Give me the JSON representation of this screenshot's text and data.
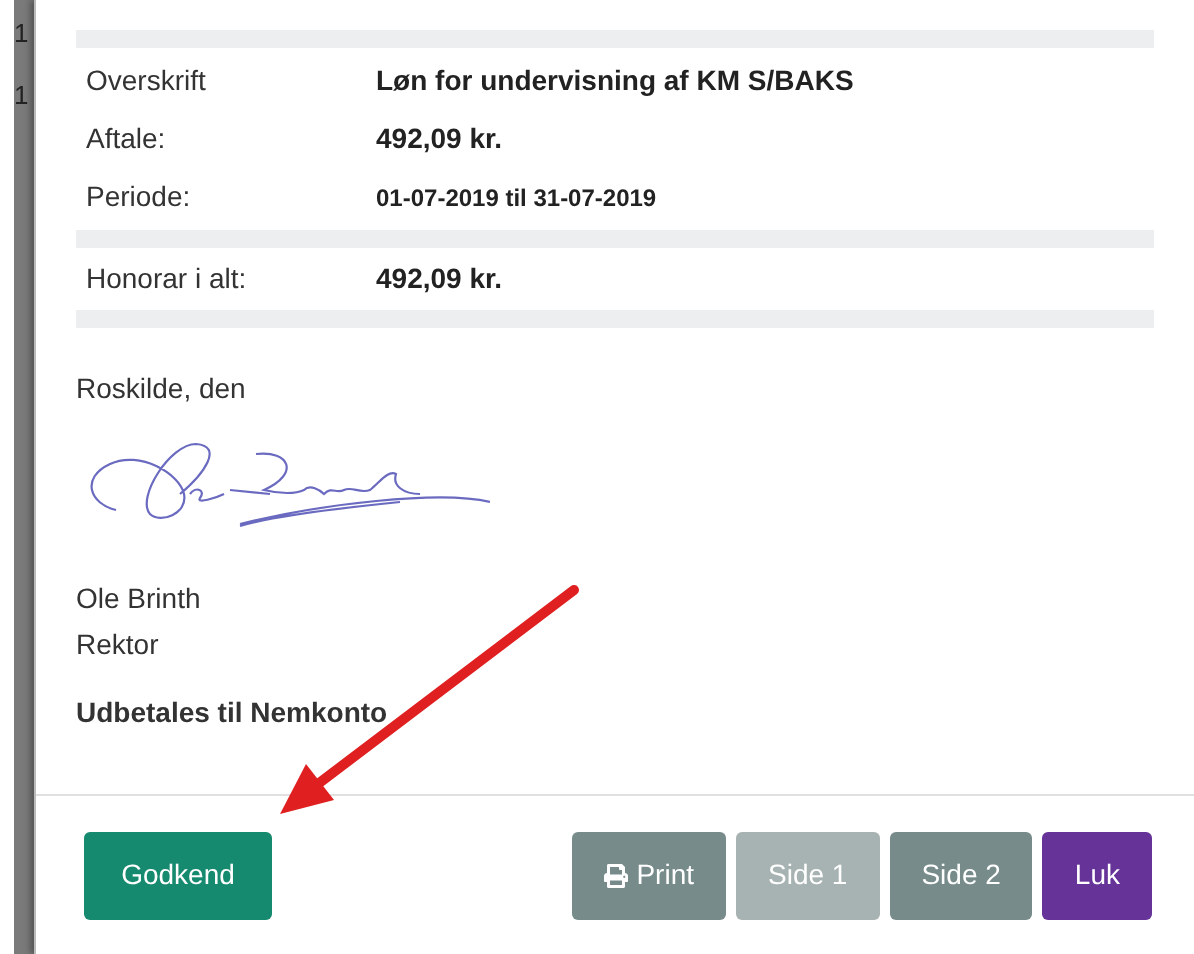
{
  "background_page": {
    "line_numbers": [
      "1",
      "1"
    ]
  },
  "details": {
    "rows": [
      {
        "label": "Overskrift",
        "value": "Løn for undervisning af KM S/BAKS",
        "kind": "text"
      },
      {
        "label": "Aftale:",
        "value": "492,09 kr.",
        "kind": "text"
      },
      {
        "label": "Periode:",
        "value": "01-07-2019 til 31-07-2019",
        "kind": "period"
      }
    ],
    "total": {
      "label": "Honorar i alt:",
      "value": "492,09 kr."
    }
  },
  "place_date": "Roskilde, den",
  "signer": {
    "name": "Ole Brinth",
    "title": "Rektor"
  },
  "payment_note": "Udbetales til Nemkonto",
  "footer": {
    "approve_button": "Godkend",
    "buttons": [
      {
        "label": "Print",
        "kind": "print",
        "disabled": false
      },
      {
        "label": "Side 1",
        "kind": "page",
        "disabled": true
      },
      {
        "label": "Side 2",
        "kind": "page",
        "disabled": false
      },
      {
        "label": "Luk",
        "kind": "close",
        "disabled": false
      }
    ]
  }
}
